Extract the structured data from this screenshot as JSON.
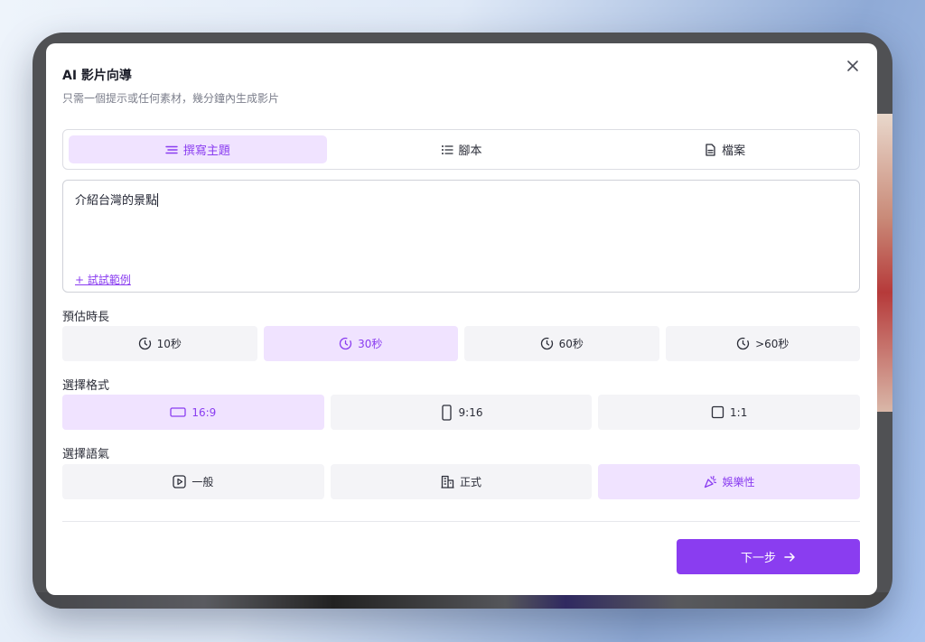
{
  "modal": {
    "title": "AI 影片向導",
    "subtitle": "只需一個提示或任何素材，幾分鐘內生成影片"
  },
  "tabs": [
    {
      "label": "撰寫主題",
      "icon": "lines-icon",
      "active": true
    },
    {
      "label": "腳本",
      "icon": "list-icon",
      "active": false
    },
    {
      "label": "檔案",
      "icon": "file-icon",
      "active": false
    }
  ],
  "prompt": {
    "value": "介紹台灣的景點",
    "example_link": "+ 試試範例"
  },
  "duration": {
    "label": "預估時長",
    "options": [
      {
        "label": "10秒",
        "icon": "clock-icon",
        "active": false
      },
      {
        "label": "30秒",
        "icon": "clock-icon",
        "active": true
      },
      {
        "label": "60秒",
        "icon": "clock-icon",
        "active": false
      },
      {
        "label": ">60秒",
        "icon": "clock-icon",
        "active": false
      }
    ]
  },
  "format": {
    "label": "選擇格式",
    "options": [
      {
        "label": "16:9",
        "icon": "landscape-icon",
        "active": true
      },
      {
        "label": "9:16",
        "icon": "portrait-icon",
        "active": false
      },
      {
        "label": "1:1",
        "icon": "square-icon",
        "active": false
      }
    ]
  },
  "tone": {
    "label": "選擇語氣",
    "options": [
      {
        "label": "一般",
        "icon": "play-icon",
        "active": false
      },
      {
        "label": "正式",
        "icon": "building-icon",
        "active": false
      },
      {
        "label": "娛樂性",
        "icon": "party-icon",
        "active": true
      }
    ]
  },
  "footer": {
    "next_label": "下一步"
  },
  "colors": {
    "accent": "#8a3df0",
    "accent_light": "#f0e3ff",
    "option_bg": "#f4f4f7"
  }
}
